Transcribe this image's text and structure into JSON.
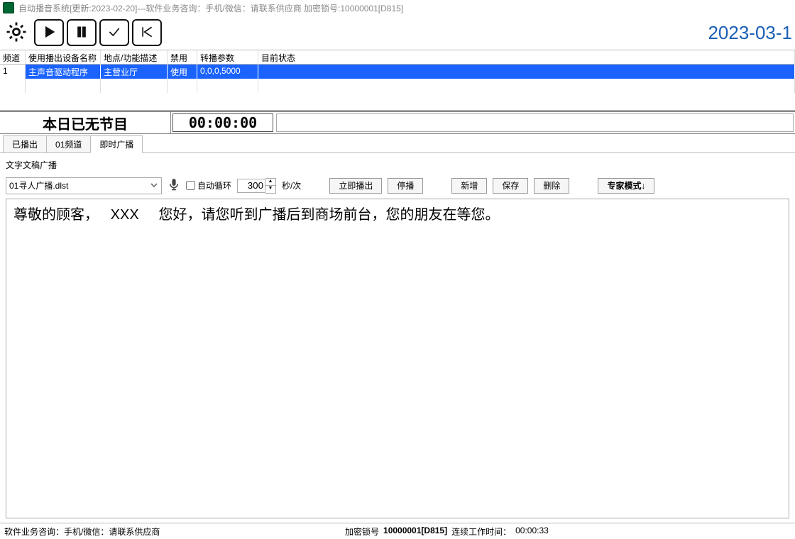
{
  "titlebar": {
    "text": "自动播音系统[更新:2023-02-20]---软件业务咨询：手机/微信：请联系供应商  加密锁号:10000001[D815]"
  },
  "toolbar": {
    "date": "2023-03-1"
  },
  "grid": {
    "headers": [
      "频道",
      "使用播出设备名称",
      "地点/功能描述",
      "禁用",
      "转播参数",
      "目前状态"
    ],
    "rows": [
      {
        "idx": "1",
        "device": "主声音驱动程序",
        "place": "主营业厅",
        "disabled": "使用",
        "params": "0,0,0,5000",
        "status": ""
      }
    ]
  },
  "progbar": {
    "msg": "本日已无节目",
    "time": "00:00:00"
  },
  "tabs": {
    "items": [
      "已播出",
      "01频道",
      "即时广播"
    ],
    "activeIndex": 2
  },
  "panel": {
    "title": "文字文稿广播",
    "combo": "01寻人广播.dlst",
    "loopLabel": "自动循环",
    "intervalValue": "300",
    "intervalUnit": "秒/次",
    "btnPlayNow": "立即播出",
    "btnStop": "停播",
    "btnNew": "新增",
    "btnSave": "保存",
    "btnDelete": "删除",
    "btnExpert": "专家模式↓",
    "text": "尊敬的顾客，   XXX     您好，请您听到广播后到商场前台，您的朋友在等您。"
  },
  "status": {
    "left": "软件业务咨询：手机/微信：请联系供应商",
    "lockLabel": "加密锁号",
    "lockValue": "10000001[D815]",
    "uptimeLabel": "连续工作时间：",
    "uptimeValue": "00:00:33"
  }
}
